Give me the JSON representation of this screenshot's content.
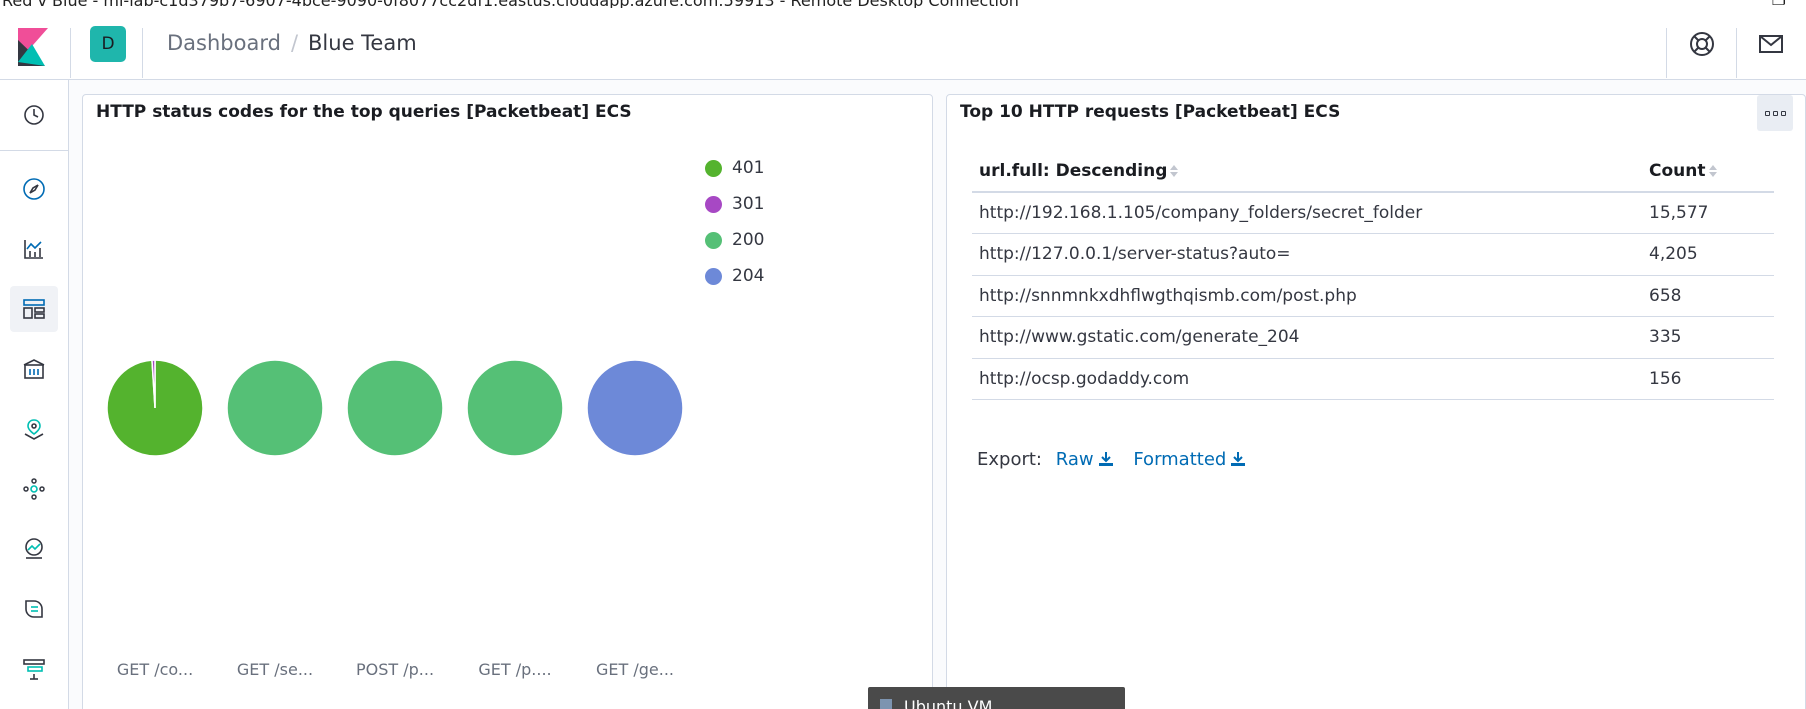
{
  "window": {
    "rdp_title": "Red v Blue - ml-lab-c1d379b7-6907-4bce-9090-0f8077cc2df1.eastus.cloudapp.azure.com:59913 - Remote Desktop Connection"
  },
  "header": {
    "space_initial": "D",
    "breadcrumb": {
      "parent": "Dashboard",
      "separator": "/",
      "current": "Blue Team"
    },
    "icons": [
      "help-icon",
      "newsfeed-icon"
    ]
  },
  "sidenav": {
    "items": [
      {
        "name": "recently-viewed",
        "icon": "clock-icon"
      },
      {
        "name": "discover",
        "icon": "compass-icon"
      },
      {
        "name": "visualize",
        "icon": "visualize-icon"
      },
      {
        "name": "dashboard",
        "icon": "dashboard-icon",
        "active": true
      },
      {
        "name": "canvas",
        "icon": "canvas-icon"
      },
      {
        "name": "maps",
        "icon": "maps-icon"
      },
      {
        "name": "ml",
        "icon": "ml-icon"
      },
      {
        "name": "infrastructure",
        "icon": "infrastructure-icon"
      },
      {
        "name": "logs",
        "icon": "logs-icon"
      },
      {
        "name": "apm",
        "icon": "apm-icon"
      }
    ]
  },
  "panel_left": {
    "title": "HTTP status codes for the top queries [Packetbeat] ECS",
    "legend": [
      {
        "label": "401",
        "color": "#54b32e"
      },
      {
        "label": "301",
        "color": "#a748c4"
      },
      {
        "label": "200",
        "color": "#55c076"
      },
      {
        "label": "204",
        "color": "#6d89d8"
      }
    ]
  },
  "chart_data": {
    "type": "pie",
    "series": [
      {
        "name": "GET /co...",
        "slices": [
          {
            "label": "401",
            "value": 99,
            "color": "#54b32e"
          },
          {
            "label": "301",
            "value": 1,
            "color": "#a748c4"
          }
        ]
      },
      {
        "name": "GET /se...",
        "slices": [
          {
            "label": "200",
            "value": 100,
            "color": "#55c076"
          }
        ]
      },
      {
        "name": "POST /p...",
        "slices": [
          {
            "label": "200",
            "value": 100,
            "color": "#55c076"
          }
        ]
      },
      {
        "name": "GET /p....",
        "slices": [
          {
            "label": "200",
            "value": 100,
            "color": "#55c076"
          }
        ]
      },
      {
        "name": "GET /ge...",
        "slices": [
          {
            "label": "204",
            "value": 100,
            "color": "#6d89d8"
          }
        ]
      }
    ],
    "legend_position": "top-right"
  },
  "panel_right": {
    "title": "Top 10 HTTP requests [Packetbeat] ECS",
    "columns": [
      "url.full: Descending",
      "Count"
    ],
    "rows": [
      {
        "url": "http://192.168.1.105/company_folders/secret_folder",
        "count": "15,577"
      },
      {
        "url": "http://127.0.0.1/server-status?auto=",
        "count": "4,205"
      },
      {
        "url": "http://snnmnkxdhflwgthqismb.com/post.php",
        "count": "658"
      },
      {
        "url": "http://www.gstatic.com/generate_204",
        "count": "335"
      },
      {
        "url": "http://ocsp.godaddy.com",
        "count": "156"
      }
    ],
    "export": {
      "label": "Export:",
      "raw": "Raw",
      "formatted": "Formatted"
    }
  },
  "taskbar_popup": {
    "text": "Ubuntu VM"
  }
}
